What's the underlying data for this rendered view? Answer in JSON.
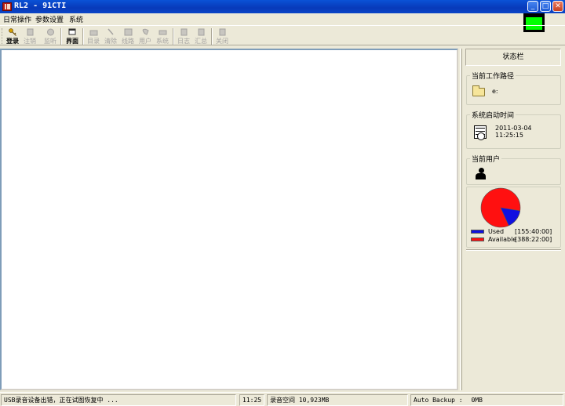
{
  "window": {
    "title": "RL2 - 91CTI",
    "minimize": "_",
    "maximize": "□",
    "close": "✕"
  },
  "menu": [
    "日常操作",
    "参数设置",
    "系统"
  ],
  "toolbar": [
    {
      "label": "登录",
      "icon": "key-icon",
      "enabled": true
    },
    {
      "label": "注销",
      "icon": "door-icon",
      "enabled": false
    },
    {
      "label": "监听",
      "icon": "headphone-icon",
      "enabled": false
    },
    {
      "label": "界面",
      "icon": "window-icon",
      "enabled": true
    },
    {
      "label": "目录",
      "icon": "folder-icon",
      "enabled": false
    },
    {
      "label": "清除",
      "icon": "broom-icon",
      "enabled": false
    },
    {
      "label": "线路",
      "icon": "disk-icon",
      "enabled": false
    },
    {
      "label": "用户",
      "icon": "phone-icon",
      "enabled": false
    },
    {
      "label": "系统",
      "icon": "printer-icon",
      "enabled": false
    },
    {
      "label": "日志",
      "icon": "book-icon",
      "enabled": false
    },
    {
      "label": "汇总",
      "icon": "notebook-icon",
      "enabled": false
    },
    {
      "label": "关闭",
      "icon": "exit-icon",
      "enabled": false
    }
  ],
  "side": {
    "title": "状态栏",
    "workpath": {
      "label": "当前工作路径",
      "value": "e:"
    },
    "starttime": {
      "label": "系统启动时间",
      "date": "2011-03-04",
      "time": "11:25:15"
    },
    "user": {
      "label": "当前用户"
    },
    "disk": {
      "used": {
        "name": "Used",
        "value": "[155:40:00]",
        "color": "#1010e0",
        "fraction": 0.286
      },
      "available": {
        "name": "Available",
        "value": "[388:22:00]",
        "color": "#ff1010",
        "fraction": 0.714
      }
    }
  },
  "status": {
    "message": "USB录音设备出错，正在试图恢复中 ...",
    "time": "11:25",
    "space": "录音空间 10,923MB",
    "backup": "Auto Backup :",
    "backup_value": "0MB"
  },
  "colors": {
    "tray": "#00ff00",
    "titlebar": "#0a52d6"
  }
}
